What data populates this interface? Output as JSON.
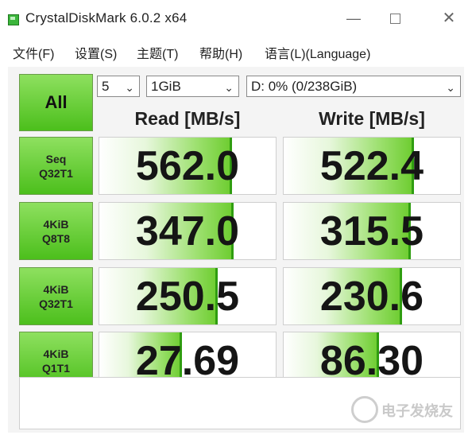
{
  "window": {
    "title": "CrystalDiskMark 6.0.2 x64",
    "minimize_glyph": "—",
    "close_glyph": "✕"
  },
  "menu": [
    {
      "label": "文件(F)"
    },
    {
      "label": "设置(S)"
    },
    {
      "label": "主题(T)"
    },
    {
      "label": "帮助(H)"
    },
    {
      "label": "语言(L)(Language)"
    }
  ],
  "controls": {
    "all_label": "All",
    "count_value": "5",
    "size_value": "1GiB",
    "drive_value": "D: 0% (0/238GiB)",
    "chevron_glyph": "⌄"
  },
  "headers": {
    "read": "Read [MB/s]",
    "write": "Write [MB/s]"
  },
  "tests": [
    {
      "line1": "Seq",
      "line2": "Q32T1",
      "read": "562.0",
      "write": "522.4",
      "read_level": 0.75,
      "write_level": 0.74
    },
    {
      "line1": "4KiB",
      "line2": "Q8T8",
      "read": "347.0",
      "write": "315.5",
      "read_level": 0.76,
      "write_level": 0.72
    },
    {
      "line1": "4KiB",
      "line2": "Q32T1",
      "read": "250.5",
      "write": "230.6",
      "read_level": 0.67,
      "write_level": 0.67
    },
    {
      "line1": "4KiB",
      "line2": "Q1T1",
      "read": "27.69",
      "write": "86.30",
      "read_level": 0.47,
      "write_level": 0.54
    }
  ],
  "comment": "",
  "watermark": "电子发烧友",
  "colors": {
    "accent_green": "#4cbf1c",
    "bar_edge": "#2f9d10"
  }
}
